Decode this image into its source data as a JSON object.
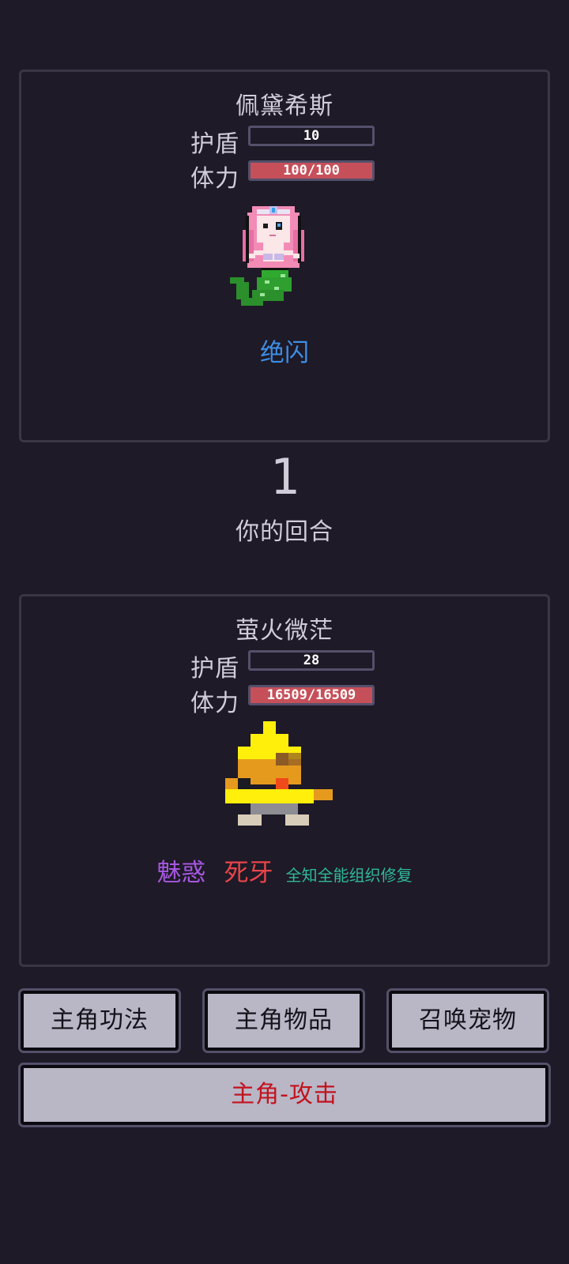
{
  "enemy": {
    "name": "佩黛希斯",
    "shield_label": "护盾",
    "shield_value": "10",
    "hp_label": "体力",
    "hp_value": "100/100",
    "sprite": "pixel-mermaid",
    "skills": [
      {
        "label": "绝闪",
        "color": "#3d8ee6"
      }
    ]
  },
  "turn": {
    "number": "1",
    "label": "你的回合"
  },
  "player": {
    "name": "萤火微茫",
    "shield_label": "护盾",
    "shield_value": "28",
    "hp_label": "体力",
    "hp_value": "16509/16509",
    "sprite": "pixel-yellow-bird",
    "skills": [
      {
        "label": "魅惑",
        "color": "#a657e0"
      },
      {
        "label": "死牙",
        "color": "#e8454a"
      },
      {
        "label": "全知全能组织修复",
        "color": "#2fb89a"
      }
    ]
  },
  "buttons": {
    "skills": "主角功法",
    "items": "主角物品",
    "summon": "召唤宠物",
    "attack": "主角-攻击"
  },
  "colors": {
    "background": "#1e1a27",
    "panel_border": "#3a3646",
    "hp_bar": "#c6505a",
    "button_bg": "#b9b6c6",
    "attack_text": "#c2131d"
  }
}
